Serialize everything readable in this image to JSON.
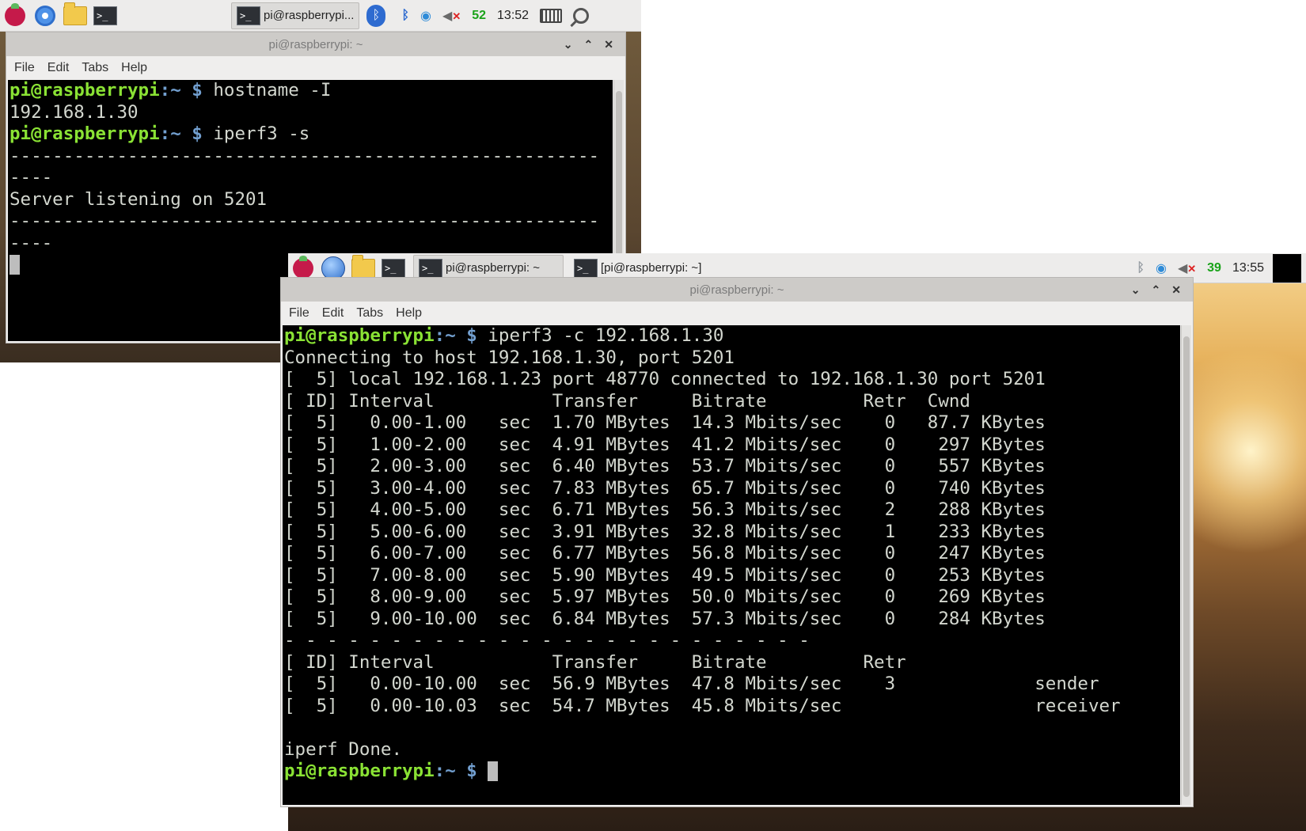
{
  "screen1": {
    "taskbar": {
      "task_button": "pi@raspberrypi...",
      "cpu": "52",
      "clock": "13:52"
    },
    "window": {
      "title": "pi@raspberrypi: ~",
      "menu": [
        "File",
        "Edit",
        "Tabs",
        "Help"
      ],
      "prompt_user": "pi@raspberrypi",
      "prompt_sep": ":",
      "prompt_path": "~ $",
      "cmd1": " hostname -I",
      "out1": "192.168.1.30",
      "cmd2": " iperf3 -s",
      "dash_line": "-------------------------------------------------------",
      "dash_wrap": "----",
      "listen": "Server listening on 5201"
    }
  },
  "screen2": {
    "taskbar": {
      "task1": "pi@raspberrypi: ~",
      "task2": "[pi@raspberrypi: ~]",
      "cpu": "39",
      "clock": "13:55"
    },
    "window": {
      "title": "pi@raspberrypi: ~",
      "menu": [
        "File",
        "Edit",
        "Tabs",
        "Help"
      ],
      "prompt_user": "pi@raspberrypi",
      "prompt_sep": ":",
      "prompt_path": "~ $",
      "cmd": " iperf3 -c 192.168.1.30",
      "lines": [
        "Connecting to host 192.168.1.30, port 5201",
        "[  5] local 192.168.1.23 port 48770 connected to 192.168.1.30 port 5201",
        "[ ID] Interval           Transfer     Bitrate         Retr  Cwnd",
        "[  5]   0.00-1.00   sec  1.70 MBytes  14.3 Mbits/sec    0   87.7 KBytes",
        "[  5]   1.00-2.00   sec  4.91 MBytes  41.2 Mbits/sec    0    297 KBytes",
        "[  5]   2.00-3.00   sec  6.40 MBytes  53.7 Mbits/sec    0    557 KBytes",
        "[  5]   3.00-4.00   sec  7.83 MBytes  65.7 Mbits/sec    0    740 KBytes",
        "[  5]   4.00-5.00   sec  6.71 MBytes  56.3 Mbits/sec    2    288 KBytes",
        "[  5]   5.00-6.00   sec  3.91 MBytes  32.8 Mbits/sec    1    233 KBytes",
        "[  5]   6.00-7.00   sec  6.77 MBytes  56.8 Mbits/sec    0    247 KBytes",
        "[  5]   7.00-8.00   sec  5.90 MBytes  49.5 Mbits/sec    0    253 KBytes",
        "[  5]   8.00-9.00   sec  5.97 MBytes  50.0 Mbits/sec    0    269 KBytes",
        "[  5]   9.00-10.00  sec  6.84 MBytes  57.3 Mbits/sec    0    284 KBytes",
        "- - - - - - - - - - - - - - - - - - - - - - - - -",
        "[ ID] Interval           Transfer     Bitrate         Retr",
        "[  5]   0.00-10.00  sec  56.9 MBytes  47.8 Mbits/sec    3             sender",
        "[  5]   0.00-10.03  sec  54.7 MBytes  45.8 Mbits/sec                  receiver",
        "",
        "iperf Done."
      ]
    }
  }
}
